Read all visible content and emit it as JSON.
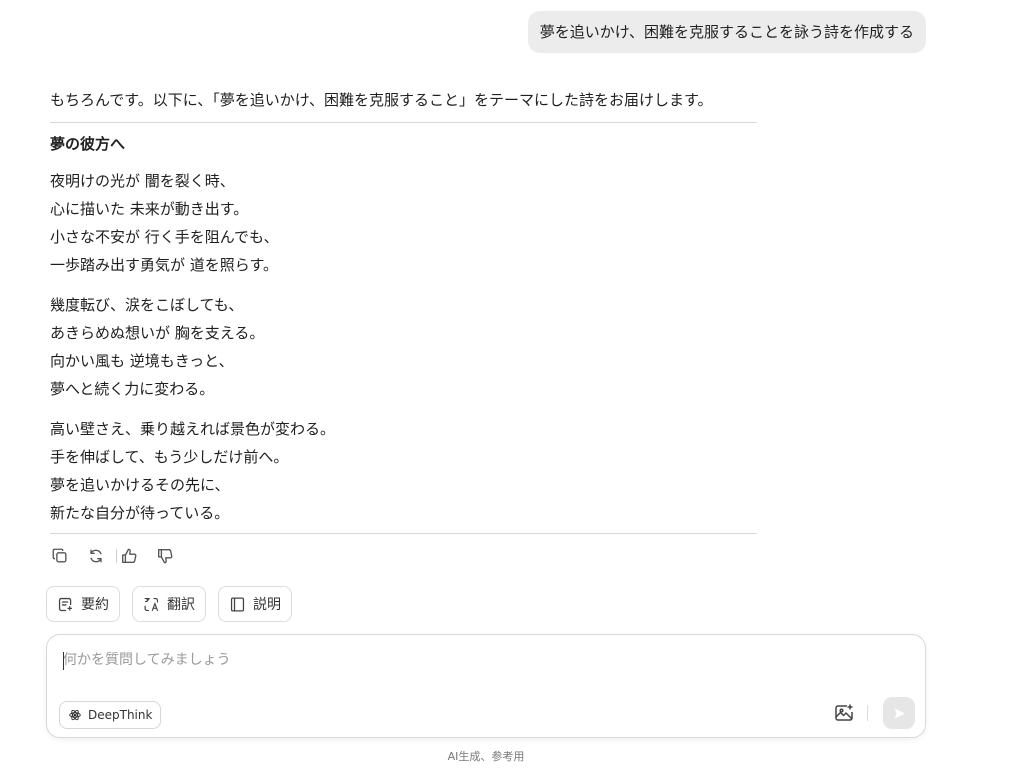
{
  "user_message": "夢を追いかけ、困難を克服することを詠う詩を作成する",
  "answer": {
    "intro": "もちろんです。以下に、「夢を追いかけ、困難を克服すること」をテーマにした詩をお届けします。",
    "poem_title": "夢の彼方へ",
    "stanzas": [
      [
        "夜明けの光が 闇を裂く時、",
        "心に描いた 未来が動き出す。",
        "小さな不安が 行く手を阻んでも、",
        "一歩踏み出す勇気が 道を照らす。"
      ],
      [
        "幾度転び、涙をこぼしても、",
        "あきらめぬ想いが 胸を支える。",
        "向かい風も 逆境もきっと、",
        "夢へと続く力に変わる。"
      ],
      [
        "高い壁さえ、乗り越えれば景色が変わる。",
        "手を伸ばして、もう少しだけ前へ。",
        "夢を追いかけるその先に、",
        "新たな自分が待っている。"
      ]
    ]
  },
  "message_actions": {
    "icons": [
      "copy-icon",
      "regenerate-icon",
      "thumbs-up-icon",
      "thumbs-down-icon"
    ]
  },
  "quick_actions": [
    {
      "label": "要約",
      "icon": "summary-icon"
    },
    {
      "label": "翻訳",
      "icon": "translate-icon"
    },
    {
      "label": "説明",
      "icon": "book-icon"
    }
  ],
  "composer": {
    "placeholder": "何かを質問してみましょう",
    "deepthink_label": "DeepThink"
  },
  "footer": "AI生成、参考用"
}
